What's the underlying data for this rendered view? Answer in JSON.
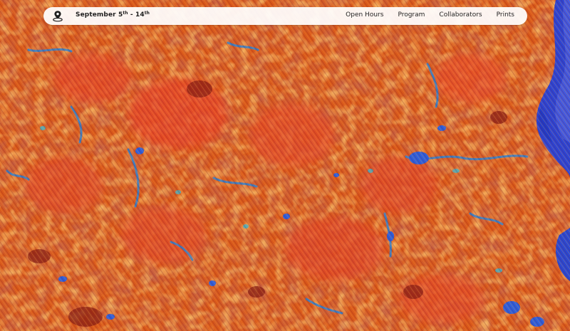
{
  "header": {
    "dates": {
      "start_month": "September",
      "start_day": "5",
      "start_suffix": "th",
      "separator": " - ",
      "end_day": "14",
      "end_suffix": "th"
    },
    "nav": [
      {
        "label": "Open Hours"
      },
      {
        "label": "Program"
      },
      {
        "label": "Collaborators"
      },
      {
        "label": "Prints"
      }
    ]
  },
  "icons": {
    "location": "map-pin-icon"
  },
  "colors": {
    "base_orange": "#d8561a",
    "dark_red": "#8a1f16",
    "light_orange": "#f08a2a",
    "water_blue": "#2a4cdc",
    "teal": "#3fa6c8",
    "bar_bg": "#ffffff"
  }
}
